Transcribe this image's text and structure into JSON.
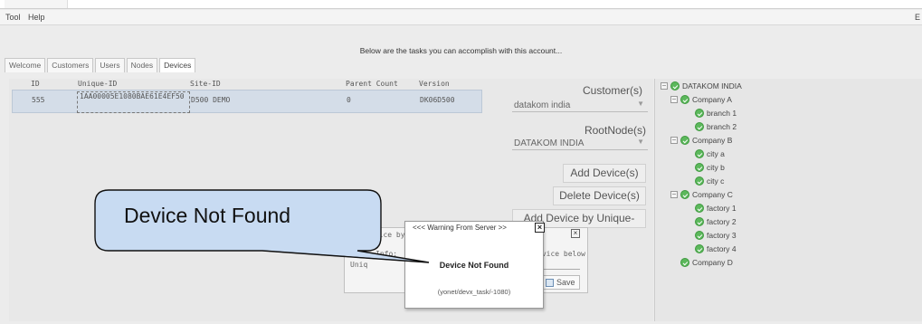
{
  "menu": {
    "tool": "Tool",
    "help": "Help",
    "right_stub": "E"
  },
  "subtitle": "Below are the tasks you can accomplish with this account...",
  "tabs": [
    "Welcome",
    "Customers",
    "Users",
    "Nodes",
    "Devices"
  ],
  "grid": {
    "headers": [
      "ID",
      "Unique-ID",
      "Site-ID",
      "Parent Count",
      "Version"
    ],
    "rows": [
      {
        "id": "555",
        "unique_id": "1AA00005E1080BAE61E4EF50",
        "site_id": "D500 DEMO",
        "parent_count": "0",
        "version": "DK06D500"
      }
    ]
  },
  "form": {
    "customer_label": "Customer(s)",
    "customer_value": "datakom india",
    "rootnode_label": "RootNode(s)",
    "rootnode_value": "DATAKOM INDIA",
    "add_button": "Add Device(s)",
    "delete_button": "Delete Device(s)",
    "add_by_uid_button": "Add Device by Unique-ID"
  },
  "tree": {
    "root": "DATAKOM INDIA",
    "items": [
      {
        "label": "Company A",
        "level": 1,
        "expander": "−"
      },
      {
        "label": "branch 1",
        "level": 2
      },
      {
        "label": "branch 2",
        "level": 2
      },
      {
        "label": "Company B",
        "level": 1,
        "expander": "−"
      },
      {
        "label": "city a",
        "level": 2
      },
      {
        "label": "city b",
        "level": 2
      },
      {
        "label": "city c",
        "level": 2
      },
      {
        "label": "Company C",
        "level": 1,
        "expander": "−"
      },
      {
        "label": "factory 1",
        "level": 2
      },
      {
        "label": "factory 2",
        "level": 2
      },
      {
        "label": "factory 3",
        "level": 2
      },
      {
        "label": "factory 4",
        "level": 2
      },
      {
        "label": "Company D",
        "level": 1
      }
    ]
  },
  "bg_dialog": {
    "title_fragment": "evice by",
    "info_label": "Info:",
    "info_text": "evice below",
    "uniq_label": "Uniq",
    "save_label": "Save"
  },
  "warning": {
    "title": "<<<  Warning From Server  >>",
    "message": "Device Not Found",
    "code": "(yonet/devx_task/-1080)"
  },
  "callout": {
    "text": "Device Not Found"
  },
  "colors": {
    "row_selected": "#d4dde8",
    "tree_icon": "#5cb85c"
  }
}
